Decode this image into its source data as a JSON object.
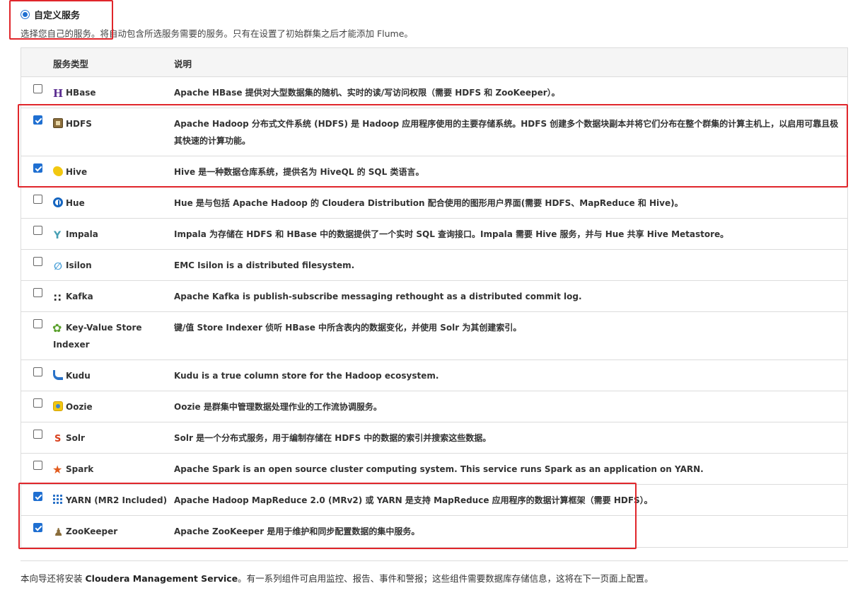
{
  "section": {
    "title": "自定义服务",
    "description": "选择您自己的服务。将自动包含所选服务需要的服务。只有在设置了初始群集之后才能添加 Flume。"
  },
  "table": {
    "header_type": "服务类型",
    "header_desc": "说明",
    "rows": [
      {
        "name": "HBase",
        "icon": "hbase-icon",
        "checked": false,
        "desc": "Apache HBase 提供对大型数据集的随机、实时的读/写访问权限（需要 HDFS 和 ZooKeeper）。"
      },
      {
        "name": "HDFS",
        "icon": "hdfs-icon",
        "checked": true,
        "desc": "Apache Hadoop 分布式文件系统 (HDFS) 是 Hadoop 应用程序使用的主要存储系统。HDFS 创建多个数据块副本并将它们分布在整个群集的计算主机上，以启用可靠且极其快速的计算功能。"
      },
      {
        "name": "Hive",
        "icon": "hive-icon",
        "checked": true,
        "desc": "Hive 是一种数据仓库系统，提供名为 HiveQL 的 SQL 类语言。"
      },
      {
        "name": "Hue",
        "icon": "hue-icon",
        "checked": false,
        "desc": "Hue 是与包括 Apache Hadoop 的 Cloudera Distribution 配合使用的图形用户界面(需要 HDFS、MapReduce 和 Hive)。"
      },
      {
        "name": "Impala",
        "icon": "impala-icon",
        "checked": false,
        "desc": "Impala 为存储在 HDFS 和 HBase 中的数据提供了一个实时 SQL 查询接口。Impala 需要 Hive 服务，并与 Hue 共享 Hive Metastore。"
      },
      {
        "name": "Isilon",
        "icon": "isilon-icon",
        "checked": false,
        "desc": "EMC Isilon is a distributed filesystem."
      },
      {
        "name": "Kafka",
        "icon": "kafka-icon",
        "checked": false,
        "desc": "Apache Kafka is publish-subscribe messaging rethought as a distributed commit log."
      },
      {
        "name": "Key-Value Store Indexer",
        "icon": "key-value-store-icon",
        "checked": false,
        "desc": "键/值 Store Indexer 侦听 HBase 中所含表内的数据变化，并使用 Solr 为其创建索引。"
      },
      {
        "name": "Kudu",
        "icon": "kudu-icon",
        "checked": false,
        "desc": "Kudu is a true column store for the Hadoop ecosystem."
      },
      {
        "name": "Oozie",
        "icon": "oozie-icon",
        "checked": false,
        "desc": "Oozie 是群集中管理数据处理作业的工作流协调服务。"
      },
      {
        "name": "Solr",
        "icon": "solr-icon",
        "checked": false,
        "desc": "Solr 是一个分布式服务，用于编制存储在 HDFS 中的数据的索引并搜索这些数据。"
      },
      {
        "name": "Spark",
        "icon": "spark-icon",
        "checked": false,
        "desc": "Apache Spark is an open source cluster computing system. This service runs Spark as an application on YARN."
      },
      {
        "name": "YARN (MR2 Included)",
        "icon": "yarn-icon",
        "checked": true,
        "desc": "Apache Hadoop MapReduce 2.0 (MRv2) 或 YARN 是支持 MapReduce 应用程序的数据计算框架（需要 HDFS）。"
      },
      {
        "name": "ZooKeeper",
        "icon": "zookeeper-icon",
        "checked": true,
        "desc": "Apache ZooKeeper 是用于维护和同步配置数据的集中服务。"
      }
    ]
  },
  "footer": {
    "prefix": "本向导还将安装 ",
    "bold": "Cloudera Management Service",
    "suffix": "。有一系列组件可启用监控、报告、事件和警报；这些组件需要数据库存储信息，这将在下一页面上配置。"
  },
  "colors": {
    "accent": "#1f6fd1",
    "highlight": "#e0262b"
  }
}
